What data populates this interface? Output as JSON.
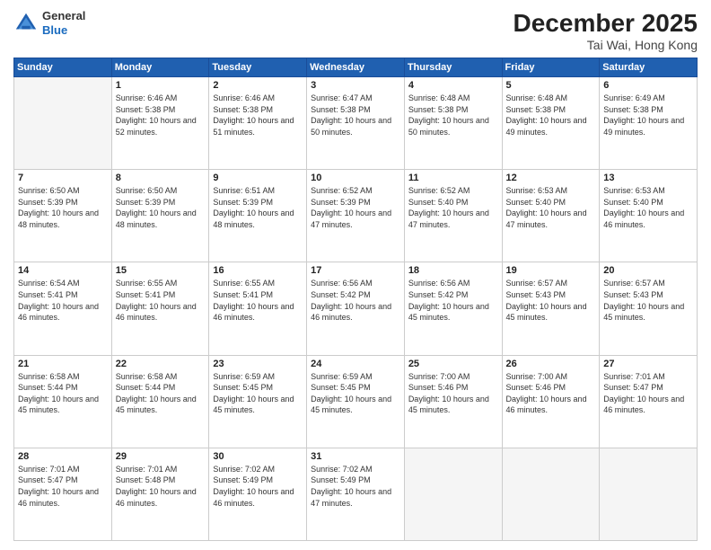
{
  "header": {
    "logo": {
      "general": "General",
      "blue": "Blue"
    },
    "title": "December 2025",
    "location": "Tai Wai, Hong Kong"
  },
  "weekdays": [
    "Sunday",
    "Monday",
    "Tuesday",
    "Wednesday",
    "Thursday",
    "Friday",
    "Saturday"
  ],
  "weeks": [
    [
      {
        "day": "",
        "empty": true
      },
      {
        "day": "1",
        "sunrise": "Sunrise: 6:46 AM",
        "sunset": "Sunset: 5:38 PM",
        "daylight": "Daylight: 10 hours and 52 minutes."
      },
      {
        "day": "2",
        "sunrise": "Sunrise: 6:46 AM",
        "sunset": "Sunset: 5:38 PM",
        "daylight": "Daylight: 10 hours and 51 minutes."
      },
      {
        "day": "3",
        "sunrise": "Sunrise: 6:47 AM",
        "sunset": "Sunset: 5:38 PM",
        "daylight": "Daylight: 10 hours and 50 minutes."
      },
      {
        "day": "4",
        "sunrise": "Sunrise: 6:48 AM",
        "sunset": "Sunset: 5:38 PM",
        "daylight": "Daylight: 10 hours and 50 minutes."
      },
      {
        "day": "5",
        "sunrise": "Sunrise: 6:48 AM",
        "sunset": "Sunset: 5:38 PM",
        "daylight": "Daylight: 10 hours and 49 minutes."
      },
      {
        "day": "6",
        "sunrise": "Sunrise: 6:49 AM",
        "sunset": "Sunset: 5:38 PM",
        "daylight": "Daylight: 10 hours and 49 minutes."
      }
    ],
    [
      {
        "day": "7",
        "sunrise": "Sunrise: 6:50 AM",
        "sunset": "Sunset: 5:39 PM",
        "daylight": "Daylight: 10 hours and 48 minutes."
      },
      {
        "day": "8",
        "sunrise": "Sunrise: 6:50 AM",
        "sunset": "Sunset: 5:39 PM",
        "daylight": "Daylight: 10 hours and 48 minutes."
      },
      {
        "day": "9",
        "sunrise": "Sunrise: 6:51 AM",
        "sunset": "Sunset: 5:39 PM",
        "daylight": "Daylight: 10 hours and 48 minutes."
      },
      {
        "day": "10",
        "sunrise": "Sunrise: 6:52 AM",
        "sunset": "Sunset: 5:39 PM",
        "daylight": "Daylight: 10 hours and 47 minutes."
      },
      {
        "day": "11",
        "sunrise": "Sunrise: 6:52 AM",
        "sunset": "Sunset: 5:40 PM",
        "daylight": "Daylight: 10 hours and 47 minutes."
      },
      {
        "day": "12",
        "sunrise": "Sunrise: 6:53 AM",
        "sunset": "Sunset: 5:40 PM",
        "daylight": "Daylight: 10 hours and 47 minutes."
      },
      {
        "day": "13",
        "sunrise": "Sunrise: 6:53 AM",
        "sunset": "Sunset: 5:40 PM",
        "daylight": "Daylight: 10 hours and 46 minutes."
      }
    ],
    [
      {
        "day": "14",
        "sunrise": "Sunrise: 6:54 AM",
        "sunset": "Sunset: 5:41 PM",
        "daylight": "Daylight: 10 hours and 46 minutes."
      },
      {
        "day": "15",
        "sunrise": "Sunrise: 6:55 AM",
        "sunset": "Sunset: 5:41 PM",
        "daylight": "Daylight: 10 hours and 46 minutes."
      },
      {
        "day": "16",
        "sunrise": "Sunrise: 6:55 AM",
        "sunset": "Sunset: 5:41 PM",
        "daylight": "Daylight: 10 hours and 46 minutes."
      },
      {
        "day": "17",
        "sunrise": "Sunrise: 6:56 AM",
        "sunset": "Sunset: 5:42 PM",
        "daylight": "Daylight: 10 hours and 46 minutes."
      },
      {
        "day": "18",
        "sunrise": "Sunrise: 6:56 AM",
        "sunset": "Sunset: 5:42 PM",
        "daylight": "Daylight: 10 hours and 45 minutes."
      },
      {
        "day": "19",
        "sunrise": "Sunrise: 6:57 AM",
        "sunset": "Sunset: 5:43 PM",
        "daylight": "Daylight: 10 hours and 45 minutes."
      },
      {
        "day": "20",
        "sunrise": "Sunrise: 6:57 AM",
        "sunset": "Sunset: 5:43 PM",
        "daylight": "Daylight: 10 hours and 45 minutes."
      }
    ],
    [
      {
        "day": "21",
        "sunrise": "Sunrise: 6:58 AM",
        "sunset": "Sunset: 5:44 PM",
        "daylight": "Daylight: 10 hours and 45 minutes."
      },
      {
        "day": "22",
        "sunrise": "Sunrise: 6:58 AM",
        "sunset": "Sunset: 5:44 PM",
        "daylight": "Daylight: 10 hours and 45 minutes."
      },
      {
        "day": "23",
        "sunrise": "Sunrise: 6:59 AM",
        "sunset": "Sunset: 5:45 PM",
        "daylight": "Daylight: 10 hours and 45 minutes."
      },
      {
        "day": "24",
        "sunrise": "Sunrise: 6:59 AM",
        "sunset": "Sunset: 5:45 PM",
        "daylight": "Daylight: 10 hours and 45 minutes."
      },
      {
        "day": "25",
        "sunrise": "Sunrise: 7:00 AM",
        "sunset": "Sunset: 5:46 PM",
        "daylight": "Daylight: 10 hours and 45 minutes."
      },
      {
        "day": "26",
        "sunrise": "Sunrise: 7:00 AM",
        "sunset": "Sunset: 5:46 PM",
        "daylight": "Daylight: 10 hours and 46 minutes."
      },
      {
        "day": "27",
        "sunrise": "Sunrise: 7:01 AM",
        "sunset": "Sunset: 5:47 PM",
        "daylight": "Daylight: 10 hours and 46 minutes."
      }
    ],
    [
      {
        "day": "28",
        "sunrise": "Sunrise: 7:01 AM",
        "sunset": "Sunset: 5:47 PM",
        "daylight": "Daylight: 10 hours and 46 minutes."
      },
      {
        "day": "29",
        "sunrise": "Sunrise: 7:01 AM",
        "sunset": "Sunset: 5:48 PM",
        "daylight": "Daylight: 10 hours and 46 minutes."
      },
      {
        "day": "30",
        "sunrise": "Sunrise: 7:02 AM",
        "sunset": "Sunset: 5:49 PM",
        "daylight": "Daylight: 10 hours and 46 minutes."
      },
      {
        "day": "31",
        "sunrise": "Sunrise: 7:02 AM",
        "sunset": "Sunset: 5:49 PM",
        "daylight": "Daylight: 10 hours and 47 minutes."
      },
      {
        "day": "",
        "empty": true
      },
      {
        "day": "",
        "empty": true
      },
      {
        "day": "",
        "empty": true
      }
    ]
  ]
}
